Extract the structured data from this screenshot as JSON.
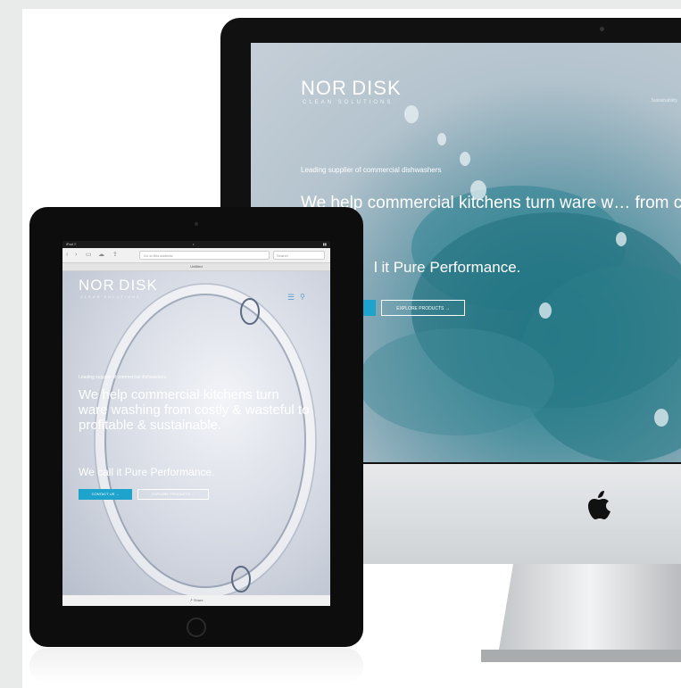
{
  "imac": {
    "brand": {
      "name": "NOR DISK",
      "sub": "CLEAN SOLUTIONS"
    },
    "nav_item": "Sustainability",
    "hero": {
      "lead": "Leading supplier of commercial dishwashers",
      "headline": "We help commercial kitchens turn ware w… from costly & wasteful to profitable & sust…",
      "tagline": "l it Pure Performance."
    },
    "buttons": {
      "products": "EXPLORE PRODUCTS →"
    }
  },
  "ipad": {
    "status": {
      "carrier": "iPad ≡",
      "time": "•",
      "battery": "▮▮"
    },
    "toolbar": {
      "url_placeholder": "Go to this address",
      "search_placeholder": "Search"
    },
    "tab_title": "Untitled",
    "brand": {
      "name": "NOR DISK",
      "sub": "CLEAN SOLUTIONS"
    },
    "hero": {
      "lead": "Leading supplier of commercial dishwashers",
      "headline": "We help commercial kitchens turn ware washing from costly & wasteful to profitable & sustainable.",
      "tagline": "We call it Pure Performance.",
      "contact_button": "CONTACT US →",
      "products_button": "EXPLORE PRODUCTS →"
    },
    "bottom_bar": "↗ Share"
  },
  "colors": {
    "accent": "#1da3cc",
    "background": "#e9eaea",
    "bezel": "#111111"
  }
}
